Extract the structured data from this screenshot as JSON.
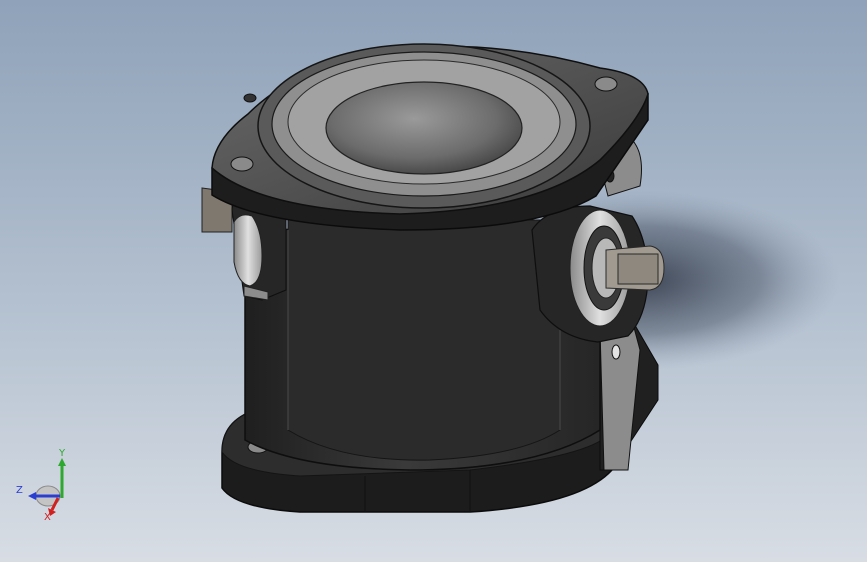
{
  "viewport": {
    "background_top": "#8fa2b9",
    "background_bottom": "#d8dde4"
  },
  "model": {
    "body_color": "#2b2b2b",
    "edge_color": "#111111",
    "highlight_color": "#8a8a8a",
    "bore_color": "#7a7a7a",
    "bearing_color": "#c9c9c9",
    "shaft_color": "#9a9a9a"
  },
  "triad": {
    "y_label": "Y",
    "z_label": "Z",
    "x_label": "X",
    "y_color": "#2fa82f",
    "z_color": "#2a3fd1",
    "x_color": "#d02020"
  }
}
